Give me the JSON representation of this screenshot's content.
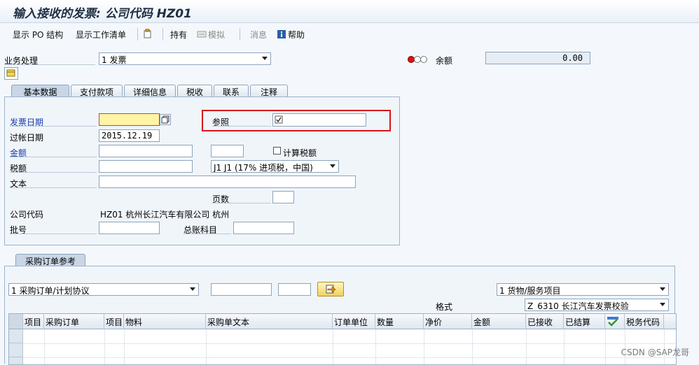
{
  "title": "输入接收的发票: 公司代码 HZ01",
  "toolbar": {
    "show_po_structure": "显示 PO 结构",
    "show_worklist": "显示工作清单",
    "hold": "持有",
    "simulate": "模拟",
    "messages": "消息",
    "help": "帮助"
  },
  "transaction": {
    "label": "业务处理",
    "value": "1 发票"
  },
  "balance": {
    "label": "余额",
    "value": "0.00"
  },
  "tabs": [
    "基本数据",
    "支付款项",
    "详细信息",
    "税收",
    "联系",
    "注释"
  ],
  "basic": {
    "invoice_date_label": "发票日期",
    "invoice_date_value": "",
    "posting_date_label": "过帐日期",
    "posting_date_value": "2015.12.19",
    "reference_label": "参照",
    "reference_value": "",
    "amount_label": "金额",
    "calc_tax_label": "计算税额",
    "tax_label": "税额",
    "tax_code_value": "J1 J1 (17% 进项税，中国)",
    "text_label": "文本",
    "page_count_label": "页数",
    "company_code_label": "公司代码",
    "company_code_value": "HZ01 杭州长江汽车有限公司 杭州",
    "batch_label": "批号",
    "gl_account_label": "总账科目"
  },
  "po_ref": {
    "tab_label": "采购订单参考",
    "doc_type_value": "1 采购订单/计划协议",
    "item_type_value": "1 货物/服务项目",
    "layout_label": "格式",
    "layout_value": "Z_6310 长江汽车发票校验"
  },
  "grid": {
    "columns": [
      "项目",
      "采购订单",
      "项目",
      "物料",
      "采购单文本",
      "订单单位",
      "数量",
      "净价",
      "金额",
      "已接收",
      "已结算",
      "",
      "税务代码"
    ]
  },
  "watermark": "CSDN @SAP龙哥",
  "colors": {
    "highlight_box": "#d9141b",
    "required_field": "#fff3a6"
  }
}
